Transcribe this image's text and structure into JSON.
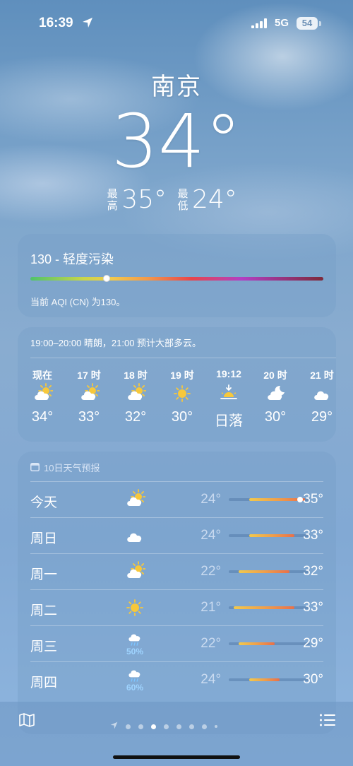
{
  "status": {
    "time": "16:39",
    "network": "5G",
    "battery": "54"
  },
  "hero": {
    "city": "南京",
    "temp": "34°",
    "high_label": "最高",
    "high": "35°",
    "low_label": "最低",
    "low": "24°"
  },
  "aqi": {
    "title": "130 - 轻度污染",
    "description": "当前 AQI (CN) 为130。",
    "value": 130,
    "level_fraction": 0.26
  },
  "hourly": {
    "summary": "19:00–20:00 晴朗，21:00 预计大部多云。",
    "items": [
      {
        "time": "现在",
        "icon": "partly-sunny-icon",
        "temp": "34°"
      },
      {
        "time": "17 时",
        "icon": "partly-sunny-icon",
        "temp": "33°"
      },
      {
        "time": "18 时",
        "icon": "partly-sunny-icon",
        "temp": "32°"
      },
      {
        "time": "19 时",
        "icon": "sun-icon",
        "temp": "30°"
      },
      {
        "time": "19:12",
        "icon": "sunset-icon",
        "temp": "日落"
      },
      {
        "time": "20 时",
        "icon": "moon-cloud-icon",
        "temp": "30°"
      },
      {
        "time": "21 时",
        "icon": "cloud-icon",
        "temp": "29°"
      }
    ]
  },
  "daily": {
    "header": "10日天气预报",
    "range_min": 20,
    "range_max": 36,
    "days": [
      {
        "name": "今天",
        "icon": "partly-sunny-icon",
        "precip": "",
        "low": "24°",
        "high": "35°",
        "low_value": 24,
        "high_value": 35,
        "current_value": 34
      },
      {
        "name": "周日",
        "icon": "cloud-icon",
        "precip": "",
        "low": "24°",
        "high": "33°",
        "low_value": 24,
        "high_value": 33
      },
      {
        "name": "周一",
        "icon": "partly-sunny-icon",
        "precip": "",
        "low": "22°",
        "high": "32°",
        "low_value": 22,
        "high_value": 32
      },
      {
        "name": "周二",
        "icon": "sun-icon",
        "precip": "",
        "low": "21°",
        "high": "33°",
        "low_value": 21,
        "high_value": 33
      },
      {
        "name": "周三",
        "icon": "rain-icon",
        "precip": "50%",
        "low": "22°",
        "high": "29°",
        "low_value": 22,
        "high_value": 29
      },
      {
        "name": "周四",
        "icon": "rain-icon",
        "precip": "60%",
        "low": "24°",
        "high": "30°",
        "low_value": 24,
        "high_value": 30
      }
    ]
  },
  "toolbar": {
    "map_icon": "map-icon",
    "list_icon": "list-icon",
    "page_count": 9,
    "active_page": 3
  }
}
